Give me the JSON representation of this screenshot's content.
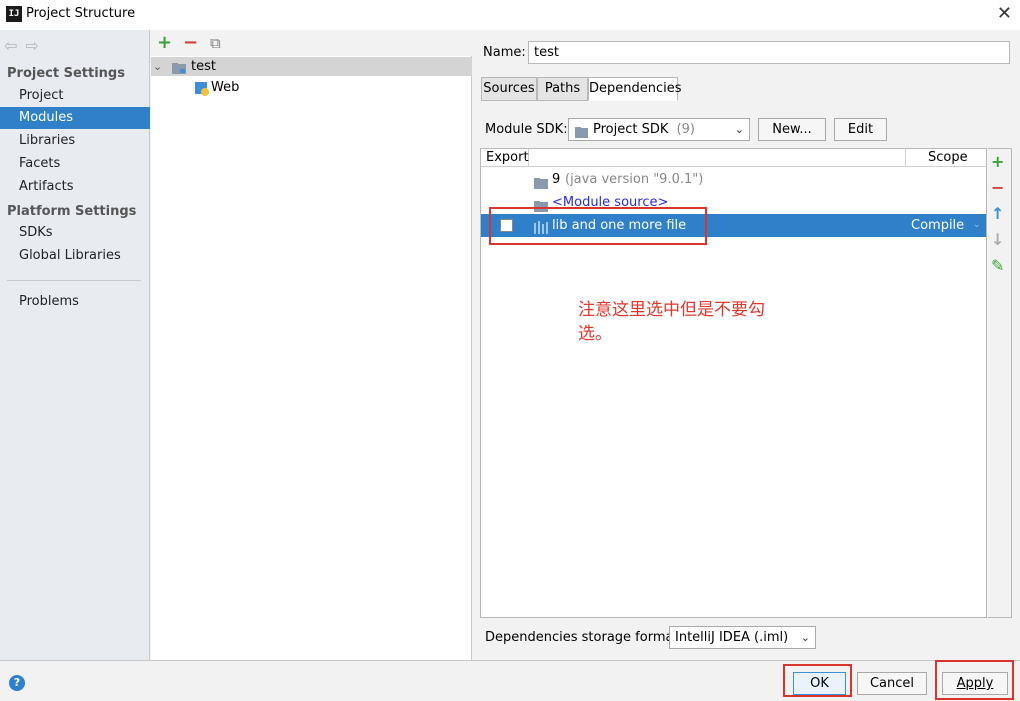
{
  "window": {
    "title": "Project Structure",
    "close": "✕",
    "app_icon": "IJ"
  },
  "nav": {
    "back": "⇦",
    "forward": "⇨"
  },
  "left": {
    "project_settings": "Project Settings",
    "project": "Project",
    "modules": "Modules",
    "libraries": "Libraries",
    "facets": "Facets",
    "artifacts": "Artifacts",
    "platform_settings": "Platform Settings",
    "sdks": "SDKs",
    "global_libraries": "Global Libraries",
    "problems": "Problems"
  },
  "middle": {
    "add": "+",
    "remove": "−",
    "copy": "⧉",
    "expand": "⌄",
    "module_name": "test",
    "facet": "Web"
  },
  "right": {
    "name_label": "Name:",
    "name_value": "test",
    "tabs": [
      "Sources",
      "Paths",
      "Dependencies"
    ],
    "module_sdk_label": "Module SDK:",
    "sdk_value": "Project SDK",
    "sdk_version": "(9)",
    "new_btn": "New...",
    "edit_btn": "Edit",
    "col_export": "Export",
    "col_scope": "Scope",
    "rows": [
      {
        "name": "9",
        "detail": "(java version \"9.0.1\")"
      },
      {
        "name": "<Module source>"
      },
      {
        "name": "lib and one more file",
        "scope": "Compile"
      }
    ],
    "storage_label": "Dependencies storage format:",
    "storage_value": "IntelliJ IDEA (.iml)",
    "dropdown_arrow": "⌄"
  },
  "sidebar_tools": {
    "add": "+",
    "remove": "−",
    "up": "↑",
    "down": "↓",
    "edit": "✎"
  },
  "annotation": "注意这里选中但是不要勾选。",
  "buttons": {
    "ok": "OK",
    "cancel": "Cancel",
    "apply": "Apply",
    "help": "?"
  },
  "colors": {
    "selection": "#2f80c9",
    "annotation": "#e0382d",
    "accent_green": "#3aa23a",
    "accent_red": "#d33f3f"
  }
}
